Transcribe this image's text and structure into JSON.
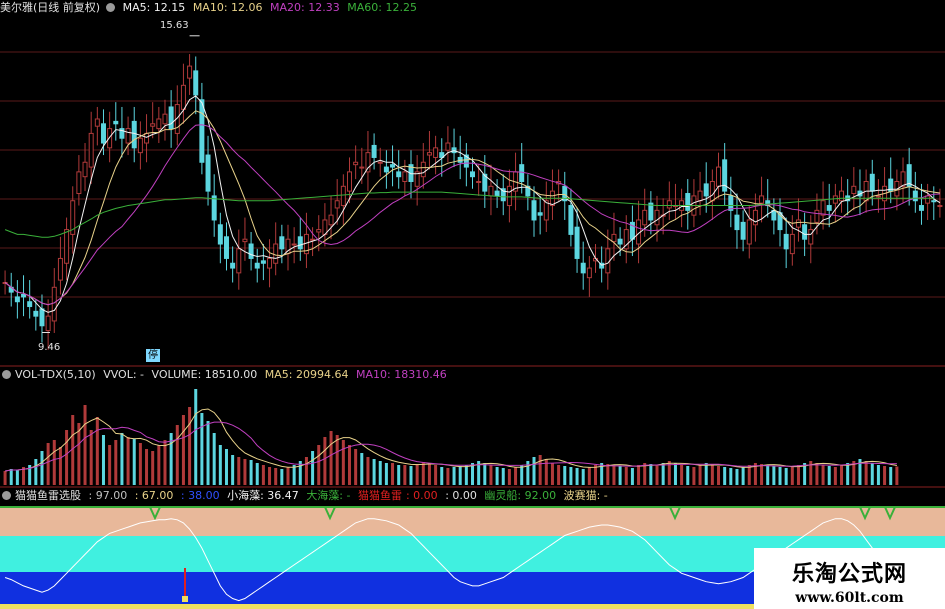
{
  "price_panel": {
    "title": "美尔雅(日线 前复权)",
    "ma5_label": "MA5: 12.15",
    "ma10_label": "MA10: 12.06",
    "ma20_label": "MA20: 12.33",
    "ma60_label": "MA60: 12.25",
    "high_marker": "15.63",
    "low_marker": "9.46",
    "stop_badge": "停"
  },
  "volume_panel": {
    "indicator_label": "VOL-TDX(5,10)",
    "vvol_label": "VVOL: -",
    "volume_label": "VOLUME: 18510.00",
    "ma5_label": "MA5: 20994.64",
    "ma10_label": "MA10: 18310.46"
  },
  "indicator_panel": {
    "name": "猫猫鱼雷选股",
    "v1": ": 97.00",
    "v2": ": 67.00",
    "v3": ": 38.00",
    "xiaohaizao": "小海藻: 36.47",
    "dahaizao": "大海藻: -",
    "yulei_label": "猫猫鱼雷",
    "yulei_value": ": 0.00",
    "v4": ": 0.00",
    "youlingchuan": "幽灵船: 92.00",
    "bosaimao": "波赛猫: -"
  },
  "watermark": {
    "title": "乐淘公式网",
    "url": "www.60lt.com"
  },
  "colors": {
    "up": "#b03a3a",
    "down": "#5cd6e0",
    "ma5": "#f2f2f2",
    "ma10": "#e8d28a",
    "ma20": "#c040c0",
    "ma60": "#3ab03a",
    "grid": "#5a1a1a"
  },
  "chart_data": [
    {
      "type": "candlestick",
      "title": "美尔雅(日线 前复权)",
      "ylim": [
        9.2,
        16.0
      ],
      "max_price": 15.63,
      "min_price": 9.46,
      "close": [
        10.5,
        10.3,
        10.1,
        10.2,
        10.0,
        9.8,
        9.6,
        9.8,
        10.4,
        11.0,
        11.6,
        12.2,
        12.8,
        13.0,
        13.6,
        13.9,
        13.4,
        13.7,
        13.8,
        13.5,
        13.7,
        13.3,
        13.5,
        13.6,
        13.8,
        13.9,
        14.0,
        13.7,
        14.2,
        14.6,
        15.0,
        14.4,
        13.0,
        12.4,
        11.8,
        11.3,
        11.0,
        10.8,
        11.2,
        11.4,
        11.0,
        10.8,
        10.9,
        11.0,
        11.3,
        11.2,
        11.4,
        11.3,
        11.2,
        11.5,
        11.4,
        11.6,
        11.8,
        11.9,
        12.2,
        12.5,
        12.8,
        13.0,
        12.9,
        13.2,
        13.1,
        13.0,
        12.8,
        12.9,
        12.7,
        12.8,
        12.6,
        12.8,
        13.0,
        13.2,
        13.3,
        13.1,
        13.4,
        13.2,
        13.0,
        12.9,
        12.7,
        12.6,
        12.4,
        12.5,
        12.3,
        12.2,
        12.5,
        12.8,
        12.6,
        12.3,
        11.8,
        11.9,
        12.2,
        12.4,
        12.6,
        12.2,
        11.5,
        11.0,
        10.7,
        10.8,
        11.0,
        10.8,
        11.2,
        11.5,
        11.3,
        11.6,
        11.4,
        11.8,
        12.0,
        11.8,
        12.0,
        11.9,
        12.2,
        12.1,
        12.2,
        12.0,
        12.3,
        12.4,
        12.3,
        12.6,
        12.9,
        12.4,
        12.0,
        11.6,
        11.4,
        11.8,
        12.0,
        12.3,
        12.1,
        11.8,
        11.6,
        11.2,
        11.5,
        11.8,
        11.4,
        11.6,
        12.0,
        12.2,
        12.0,
        12.3,
        12.4,
        12.2,
        12.5,
        12.3,
        12.6,
        12.4,
        12.3,
        12.5,
        12.4,
        12.6,
        12.8,
        12.5,
        12.2,
        12.0,
        12.3,
        12.2,
        12.1
      ],
      "ma60": [
        11.6,
        11.55,
        11.5,
        11.5,
        11.48,
        11.46,
        11.44,
        11.44,
        11.46,
        11.5,
        11.55,
        11.6,
        11.68,
        11.75,
        11.82,
        11.9,
        11.96,
        12.0,
        12.04,
        12.07,
        12.1,
        12.12,
        12.14,
        12.16,
        12.18,
        12.2,
        12.22,
        12.22,
        12.23,
        12.24,
        12.25,
        12.26,
        12.26,
        12.25,
        12.24,
        12.23,
        12.22,
        12.21,
        12.2,
        12.2,
        12.2,
        12.2,
        12.2,
        12.2,
        12.21,
        12.22,
        12.23,
        12.24,
        12.25,
        12.26,
        12.27,
        12.28,
        12.29,
        12.3,
        12.31,
        12.32,
        12.33,
        12.34,
        12.35,
        12.36,
        12.36,
        12.37,
        12.37,
        12.38,
        12.38,
        12.38,
        12.38,
        12.38,
        12.38,
        12.38,
        12.38,
        12.38,
        12.37,
        12.36,
        12.35,
        12.34,
        12.33,
        12.32,
        12.31,
        12.3,
        12.29,
        12.28,
        12.28,
        12.28,
        12.28,
        12.27,
        12.26,
        12.25,
        12.25,
        12.25,
        12.25,
        12.25,
        12.24,
        12.23,
        12.22,
        12.21,
        12.2,
        12.19,
        12.18,
        12.17,
        12.16,
        12.15,
        12.14,
        12.13,
        12.12,
        12.11,
        12.1,
        12.1,
        12.1,
        12.1,
        12.1,
        12.1,
        12.1,
        12.1,
        12.1,
        12.1,
        12.1,
        12.1,
        12.1,
        12.1,
        12.1,
        12.1,
        12.11,
        12.12,
        12.13,
        12.14,
        12.15,
        12.16,
        12.17,
        12.18,
        12.19,
        12.2,
        12.21,
        12.22,
        12.23,
        12.24,
        12.25,
        12.25,
        12.25,
        12.25,
        12.25,
        12.25,
        12.25,
        12.25,
        12.25,
        12.25,
        12.25,
        12.25,
        12.25,
        12.25,
        12.25,
        12.25
      ]
    },
    {
      "type": "bar",
      "title": "VOL-TDX(5,10)",
      "volume": 18510.0,
      "ma5": 20994.64,
      "ma10": 18310.46,
      "values": [
        14000,
        16000,
        15000,
        18000,
        20000,
        26000,
        34000,
        42000,
        45000,
        38000,
        55000,
        70000,
        62000,
        80000,
        55000,
        68000,
        50000,
        40000,
        45000,
        52000,
        48000,
        46000,
        42000,
        36000,
        34000,
        40000,
        45000,
        52000,
        60000,
        70000,
        78000,
        96000,
        72000,
        64000,
        52000,
        40000,
        36000,
        30000,
        28000,
        26000,
        25000,
        22000,
        20000,
        18000,
        17000,
        16000,
        18000,
        20000,
        24000,
        28000,
        34000,
        40000,
        48000,
        54000,
        50000,
        45000,
        40000,
        36000,
        32000,
        28000,
        26000,
        24000,
        22000,
        22000,
        20000,
        20000,
        19000,
        21000,
        23000,
        22000,
        20000,
        18000,
        17000,
        18000,
        19000,
        20000,
        22000,
        24000,
        22000,
        20000,
        18000,
        17000,
        16000,
        18000,
        20000,
        24000,
        28000,
        30000,
        26000,
        22000,
        20000,
        19000,
        18000,
        17000,
        16000,
        18000,
        20000,
        22000,
        21000,
        20000,
        19000,
        18000,
        17000,
        20000,
        22000,
        21000,
        20000,
        22000,
        24000,
        22000,
        20000,
        19000,
        18000,
        20000,
        22000,
        21000,
        19000,
        18000,
        17000,
        16000,
        18000,
        20000,
        22000,
        21000,
        20000,
        19000,
        18000,
        17000,
        18000,
        20000,
        22000,
        24000,
        22000,
        20000,
        19000,
        18000,
        20000,
        22000,
        24000,
        26000,
        24000,
        22000,
        20000,
        19000,
        18000,
        18510
      ],
      "ymax": 100000
    },
    {
      "type": "line",
      "title": "猫猫鱼雷选股",
      "ylim": [
        0,
        100
      ],
      "series": [
        {
          "name": "小海藻",
          "values": [
            30,
            28,
            25,
            22,
            20,
            18,
            16,
            18,
            22,
            28,
            34,
            40,
            46,
            52,
            58,
            64,
            68,
            72,
            74,
            76,
            78,
            80,
            82,
            83,
            84,
            85,
            85,
            86,
            85,
            82,
            76,
            68,
            58,
            46,
            34,
            22,
            14,
            10,
            8,
            10,
            14,
            18,
            22,
            26,
            30,
            34,
            38,
            42,
            46,
            50,
            54,
            58,
            62,
            66,
            70,
            74,
            78,
            82,
            84,
            86,
            86,
            85,
            84,
            82,
            80,
            76,
            72,
            66,
            60,
            54,
            48,
            42,
            36,
            30,
            26,
            24,
            22,
            22,
            24,
            26,
            28,
            30,
            34,
            38,
            42,
            46,
            50,
            54,
            58,
            62,
            66,
            70,
            72,
            74,
            76,
            78,
            79,
            80,
            80,
            79,
            78,
            76,
            74,
            70,
            66,
            60,
            54,
            48,
            42,
            38,
            34,
            32,
            30,
            28,
            26,
            25,
            24,
            25,
            26,
            28,
            30,
            34,
            38,
            42,
            46,
            50,
            54,
            58,
            62,
            66,
            70,
            74,
            78,
            82,
            84,
            86,
            86,
            84,
            80,
            74,
            66,
            58,
            50,
            44,
            40,
            38,
            36,
            36,
            36,
            36.47
          ]
        }
      ]
    }
  ]
}
